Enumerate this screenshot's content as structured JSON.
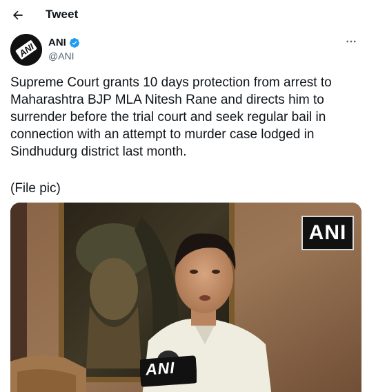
{
  "header": {
    "title": "Tweet",
    "back_icon": "arrow-left-icon"
  },
  "author": {
    "name": "ANI",
    "handle": "@ANI",
    "verified_icon": "verified-badge-icon",
    "more_icon": "more-horizontal-icon",
    "avatar_text": "ANI"
  },
  "tweet": {
    "text": "Supreme Court grants 10 days protection from arrest to Maharashtra BJP MLA Nitesh Rane and directs him to surrender before the trial court and seek regular bail in connection with an attempt to murder case lodged in Sindhudurg district last month.",
    "caption": "(File pic)"
  },
  "media": {
    "watermark": "ANI",
    "mic_label": "ANI"
  },
  "colors": {
    "text": "#0f1419",
    "secondary": "#536471",
    "verified": "#1d9bf0"
  }
}
